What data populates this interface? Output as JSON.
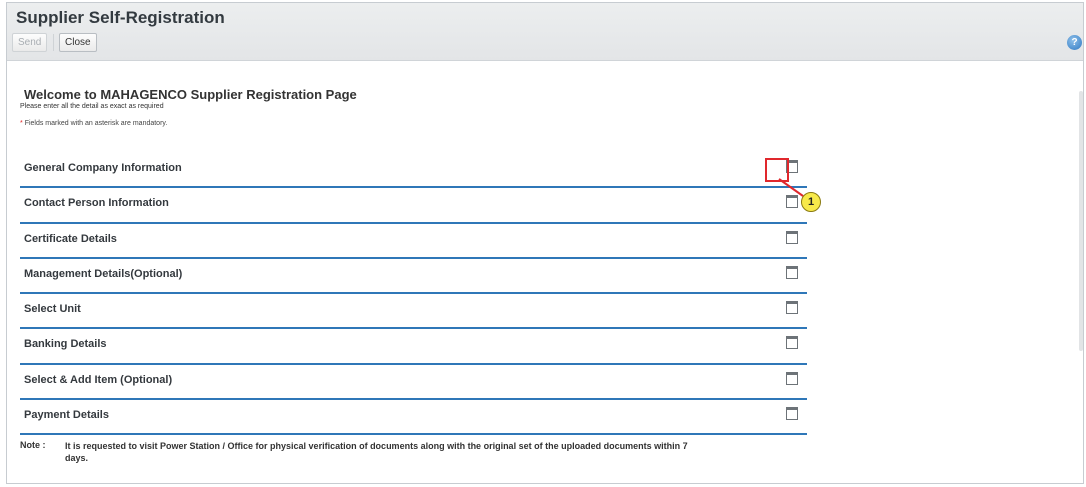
{
  "header": {
    "title": "Supplier Self-Registration",
    "send_label": "Send",
    "close_label": "Close",
    "help_icon": "help-icon",
    "help_glyph": "?"
  },
  "main": {
    "welcome": "Welcome to MAHAGENCO Supplier Registration Page",
    "instruction": "Please enter all the detail as exact as required",
    "mandatory_star": "*",
    "mandatory_text": "Fields marked with an asterisk are mandatory.",
    "sections": [
      {
        "label": "General Company Information",
        "icon": "expand-icon"
      },
      {
        "label": "Contact Person Information",
        "icon": "expand-icon"
      },
      {
        "label": "Certificate Details",
        "icon": "expand-icon"
      },
      {
        "label": "Management Details(Optional)",
        "icon": "expand-icon"
      },
      {
        "label": "Select Unit",
        "icon": "expand-icon"
      },
      {
        "label": "Banking Details",
        "icon": "expand-icon"
      },
      {
        "label": "Select & Add Item (Optional)",
        "icon": "expand-icon"
      },
      {
        "label": "Payment Details",
        "icon": "expand-icon"
      }
    ],
    "note_label": "Note :",
    "note_text": "It is requested to visit Power Station / Office for physical verification of documents along with the original set of the uploaded documents within 7 days."
  },
  "annotation": {
    "badge": "1",
    "highlight_color": "#e0282d",
    "badge_color": "#f7e94a"
  },
  "colors": {
    "section_divider": "#2f77b8",
    "title_text": "#333a40"
  }
}
